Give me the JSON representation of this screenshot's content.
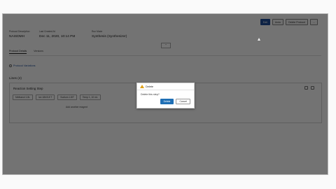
{
  "toolbar": {
    "buttons": [
      "Edit",
      "Undo",
      "Delete Protocol",
      "..."
    ]
  },
  "meta": {
    "items": [
      {
        "label": "Protocol Description",
        "value": "NAISDMH"
      },
      {
        "label": "Last Created At",
        "value": "Dec 11, 2020, 10:14 PM"
      },
      {
        "label": "Run Mode",
        "value": "Synthesis (Synthesizer)"
      }
    ]
  },
  "tabs": [
    {
      "label": "Protocol Details",
      "active": true
    },
    {
      "label": "Versions",
      "active": false
    }
  ],
  "link_text": "Protocol Variations",
  "section": {
    "title": "Lines (4)",
    "card_title": "Reaction Setting Step",
    "chips": [
      "Methanol 1.8L",
      "Ion 18h/0.8 T",
      "Sodium 1.8/T",
      "Temp 1, 10 mL"
    ],
    "note": "Add another reagent"
  },
  "dialog": {
    "title": "Delete",
    "body": "Delete this step?",
    "confirm": "Delete",
    "cancel": "Cancel"
  }
}
